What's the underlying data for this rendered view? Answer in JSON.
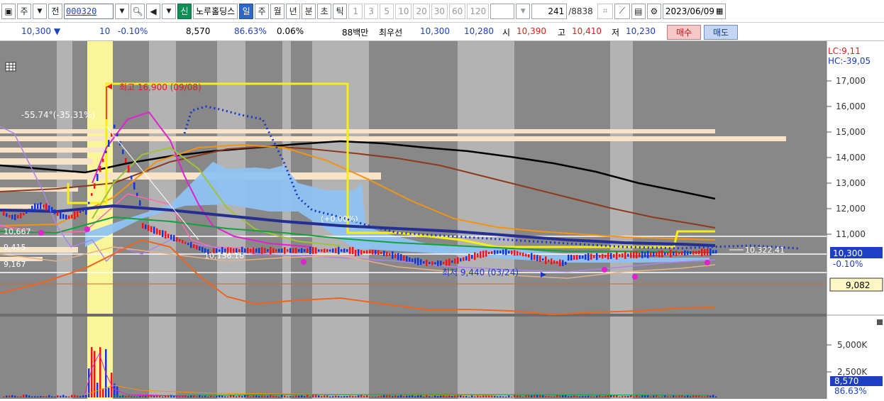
{
  "toolbar": {
    "market_label": "주",
    "prev_label": "전",
    "stock_code": "000320",
    "stock_name": "노루홀딩스",
    "period_day": "일",
    "period_week": "주",
    "period_month": "월",
    "period_year": "년",
    "period_min": "분",
    "period_sec": "초",
    "period_tick": "틱",
    "intervals": [
      "1",
      "3",
      "5",
      "10",
      "20",
      "30",
      "60",
      "120"
    ],
    "bar_count": "241",
    "bar_total": "/8838",
    "date": "2023/06/09",
    "credit_label": "신"
  },
  "quote": {
    "price": "10,300",
    "arrow": "▼",
    "change": "10",
    "change_pct": "-0.10%",
    "volume": "8,570",
    "volume_ratio": "86.63%",
    "turnover": "0.06%",
    "amount": "88백만",
    "best_bid_label": "최우선",
    "best_ask": "10,300",
    "best_bid": "10,280",
    "open_label": "시",
    "open": "10,390",
    "high_label": "고",
    "high": "10,410",
    "low_label": "저",
    "low": "10,230",
    "buy_label": "매수",
    "sell_label": "매도"
  },
  "chart": {
    "lc_label": "LC:9,11",
    "hc_label": "HC:-39,05",
    "price_axis": [
      "17,000",
      "16,000",
      "15,000",
      "14,000",
      "13,000",
      "12,000",
      "11,000"
    ],
    "current_price_tag": "10,300",
    "current_change_tag": "-0.10%",
    "ma_price_tag": "9,082",
    "volume_axis": [
      "5,000K",
      "2,500K"
    ],
    "volume_tag": "8,570",
    "volume_ratio_tag": "86.63%",
    "annot_high": "최고 16,900 (09/08)",
    "annot_low": "최저 9,440 (03/24)",
    "annot_angle": "-55.74°(-35.31%)",
    "annot_left1": "10,667",
    "annot_left2": "9,415",
    "annot_left3": "9,167",
    "annot_mid": "10,156.16",
    "annot_mid2": "(+0.00%)",
    "annot_right": "10,322.41",
    "colors": {
      "candle_up": "#e51919",
      "candle_down": "#1636d1",
      "ma_black": "#000000",
      "ma_brown": "#8b3a1b",
      "ma_orange": "#f39313",
      "ma_yellow": "#f6ee14",
      "ma_magenta": "#e021d0",
      "ma_navy": "#252f91",
      "cloud": "#8fc3f2",
      "volume_highlight": "#fbf59a"
    }
  }
}
